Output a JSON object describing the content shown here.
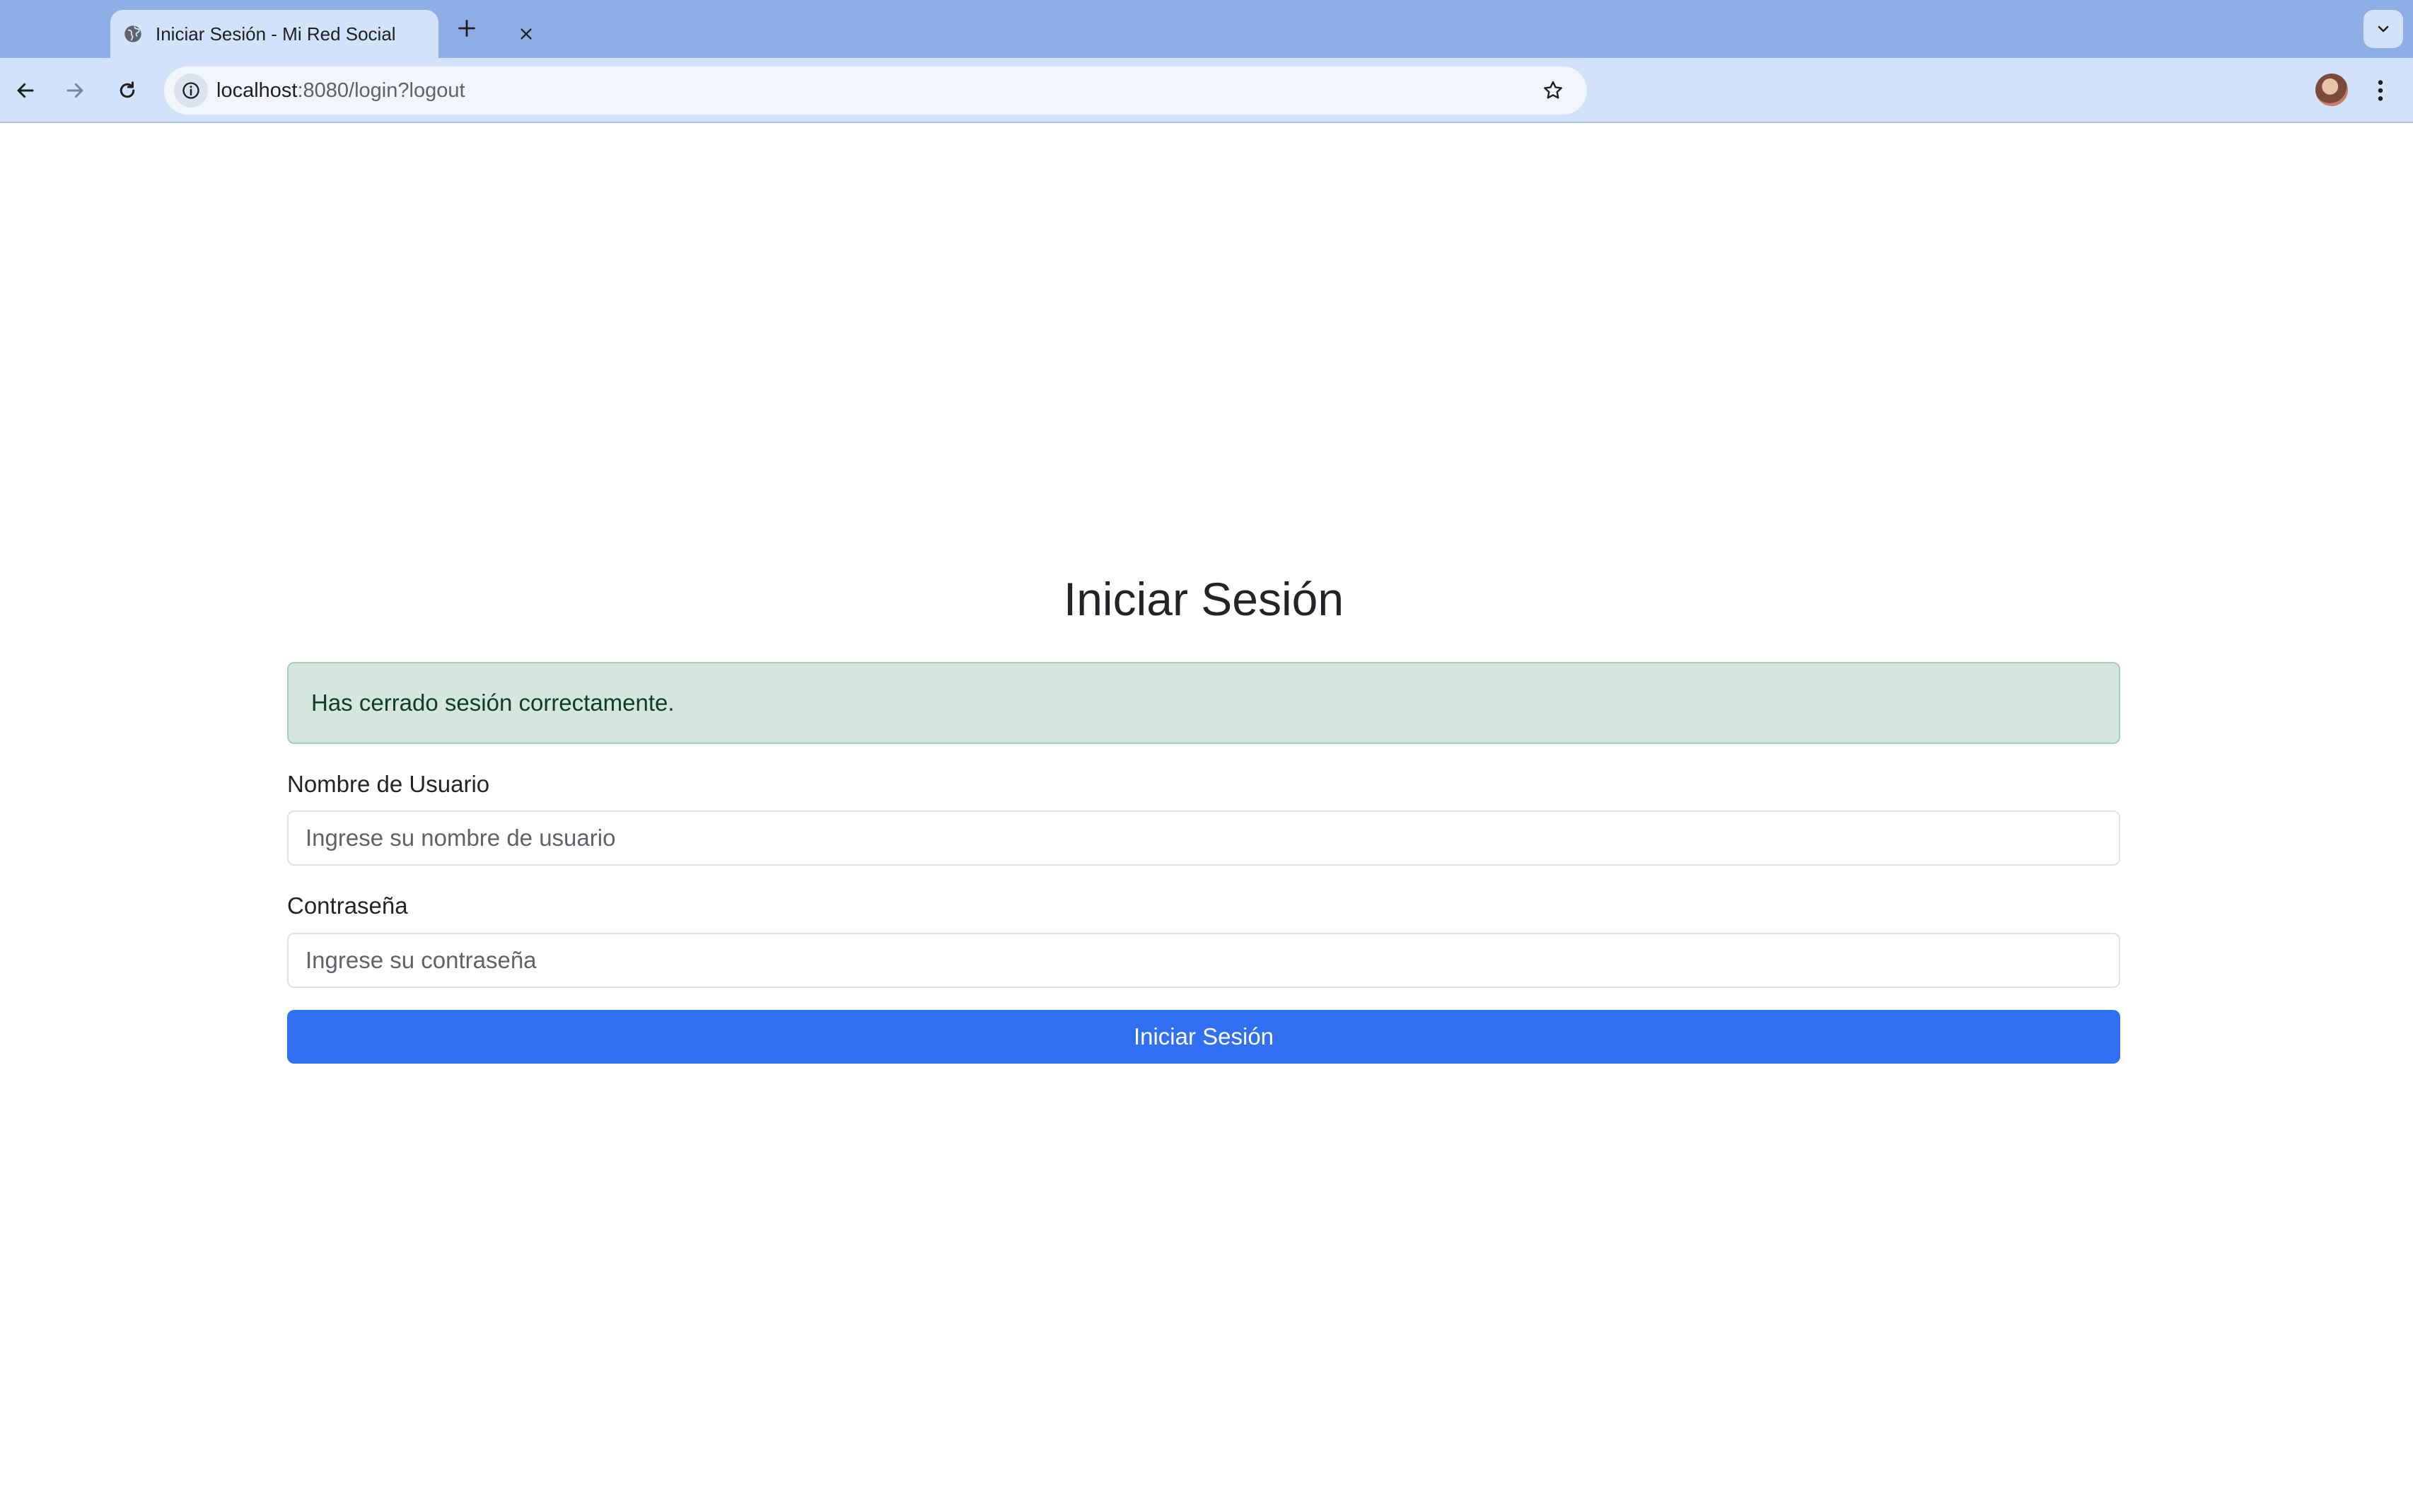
{
  "browser": {
    "tab_title": "Iniciar Sesión - Mi Red Social",
    "url_host": "localhost",
    "url_rest": ":8080/login?logout"
  },
  "page": {
    "heading": "Iniciar Sesión",
    "alert": "Has cerrado sesión correctamente.",
    "username_label": "Nombre de Usuario",
    "username_placeholder": "Ingrese su nombre de usuario",
    "password_label": "Contraseña",
    "password_placeholder": "Ingrese su contraseña",
    "submit_label": "Iniciar Sesión"
  },
  "colors": {
    "tabstrip": "#8eaee6",
    "toolbar": "#d3e2fb",
    "primary_button": "#316ff3",
    "alert_bg": "#d4e6dd",
    "alert_border": "#a6cfb8"
  },
  "icons": [
    "globe-icon",
    "close-icon",
    "plus-icon",
    "chevron-down-icon",
    "back-arrow-icon",
    "forward-arrow-icon",
    "reload-icon",
    "info-icon",
    "star-icon",
    "avatar",
    "kebab-menu-icon"
  ]
}
